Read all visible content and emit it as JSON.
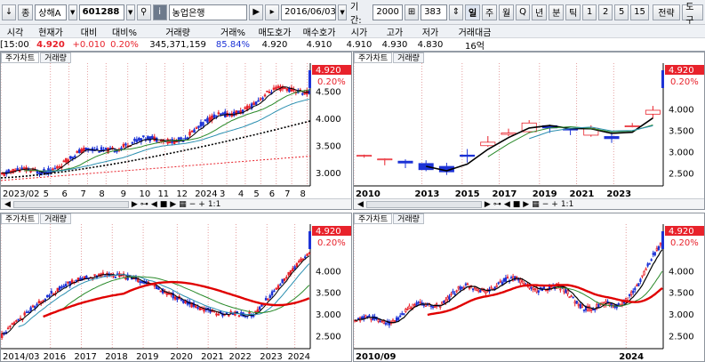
{
  "toolbar": {
    "market": "상해A",
    "code": "601288",
    "stock_name": "농업은행",
    "date": "2016/06/03",
    "period_label": "기간:",
    "period_value": "2000",
    "count_value": "383",
    "timeframes": [
      "일",
      "주",
      "월",
      "Q",
      "년",
      "분",
      "틱",
      "1",
      "2",
      "5",
      "15"
    ],
    "strategy": "전략",
    "tools": "도구"
  },
  "quote": {
    "headers": [
      "시각",
      "현재가",
      "대비",
      "대비%",
      "거래량",
      "거래%",
      "매도호가",
      "매수호가",
      "시가",
      "고가",
      "저가",
      "거래대금"
    ],
    "values": [
      "[15:00]",
      "4.920",
      "+0.010",
      "0.20%",
      "345,371,159",
      "85.84%",
      "4.920",
      "4.910",
      "4.910",
      "4.930",
      "4.830",
      "16억"
    ]
  },
  "pane_tab_chart": "주가차트",
  "pane_tab_volume": "거래량",
  "panes": [
    {
      "price": "4.920",
      "change_pct": "0.20%",
      "yticks": [
        "4.500",
        "4.000",
        "3.500",
        "3.000"
      ],
      "xticks": [
        "2023/02",
        "5",
        "6",
        "7",
        "8",
        "9",
        "10",
        "11",
        "12",
        "2024",
        "3",
        "4",
        "5",
        "6",
        "7",
        "8"
      ]
    },
    {
      "price": "4.920",
      "change_pct": "0.20%",
      "yticks": [
        "4.000",
        "3.500",
        "3.000",
        "2.500"
      ],
      "xticks": [
        "2010",
        "2013",
        "2015",
        "2017",
        "2019",
        "2021",
        "2023"
      ]
    },
    {
      "price": "4.920",
      "change_pct": "0.20%",
      "yticks": [
        "4.000",
        "3.500",
        "3.000",
        "2.500"
      ],
      "xticks": [
        "2014/03",
        "2016",
        "2017",
        "2018",
        "2019",
        "2020",
        "2021",
        "2022",
        "2023",
        "2024"
      ]
    },
    {
      "price": "4.920",
      "change_pct": "0.20%",
      "yticks": [
        "4.000",
        "3.500",
        "3.000",
        "2.500"
      ],
      "xticks": [
        "2010/09",
        "2024"
      ]
    }
  ],
  "scroll_zoom": "1:1",
  "colors": {
    "up": "#e8222b",
    "down": "#1d33d6",
    "ma_short": "#000000",
    "ma_mid": "#2a8a2a",
    "ma_long": "#e00000",
    "ma_teal": "#2b8fb0"
  }
}
